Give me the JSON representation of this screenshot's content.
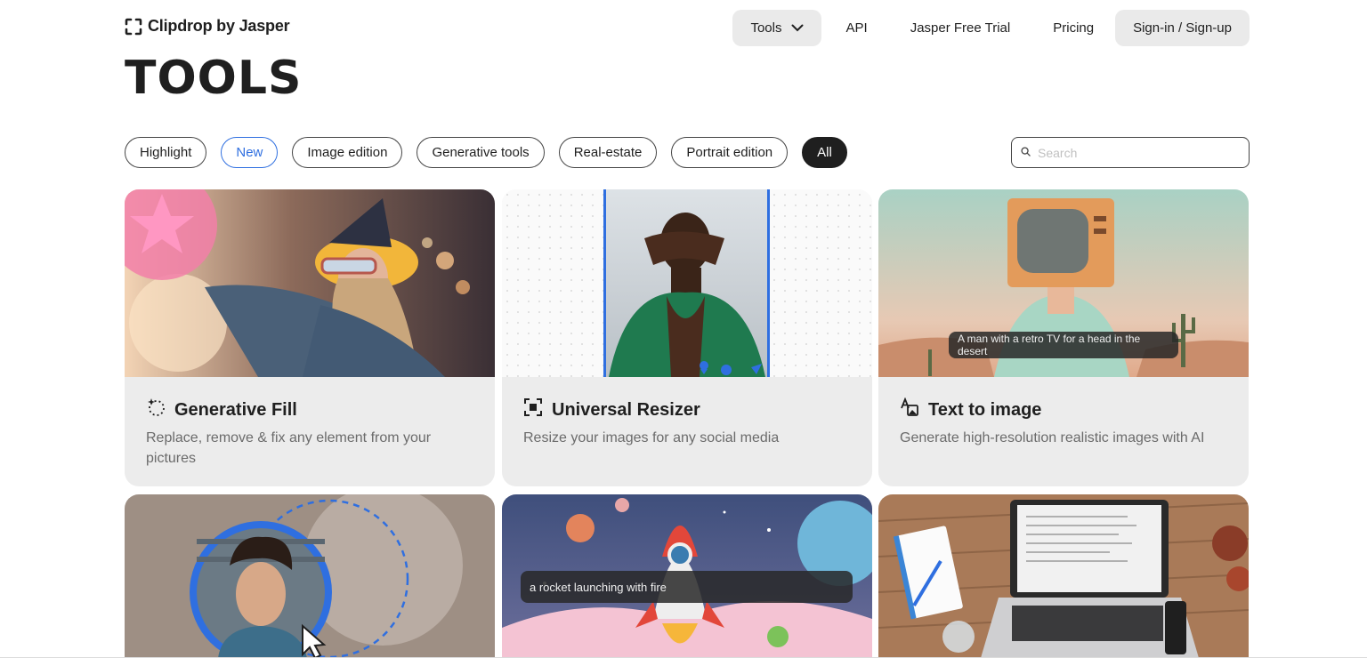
{
  "header": {
    "brand": "Clipdrop by Jasper",
    "nav": {
      "tools": "Tools",
      "api": "API",
      "trial": "Jasper Free Trial",
      "pricing": "Pricing",
      "sign": "Sign-in / Sign-up"
    }
  },
  "page_title": "TOOLS",
  "filters": [
    "Highlight",
    "New",
    "Image edition",
    "Generative tools",
    "Real-estate",
    "Portrait edition",
    "All"
  ],
  "active_filter": "All",
  "search": {
    "placeholder": "Search",
    "value": ""
  },
  "cards": [
    {
      "title": "Generative Fill",
      "desc": "Replace, remove & fix any element from your pictures",
      "icon": "sparkle-dotted-icon"
    },
    {
      "title": "Universal Resizer",
      "desc": "Resize your images for any social media",
      "icon": "resize-frame-icon"
    },
    {
      "title": "Text to image",
      "desc": "Generate high-resolution realistic images with AI",
      "icon": "text-image-icon",
      "caption": "A man with a retro TV for a head in the desert"
    },
    {
      "caption": ""
    },
    {
      "caption": "a rocket launching with fire"
    },
    {
      "caption": ""
    }
  ],
  "colors": {
    "accent_blue": "#2f6fe0",
    "card_bg": "#ececec",
    "chip_active": "#1f1f1f"
  }
}
